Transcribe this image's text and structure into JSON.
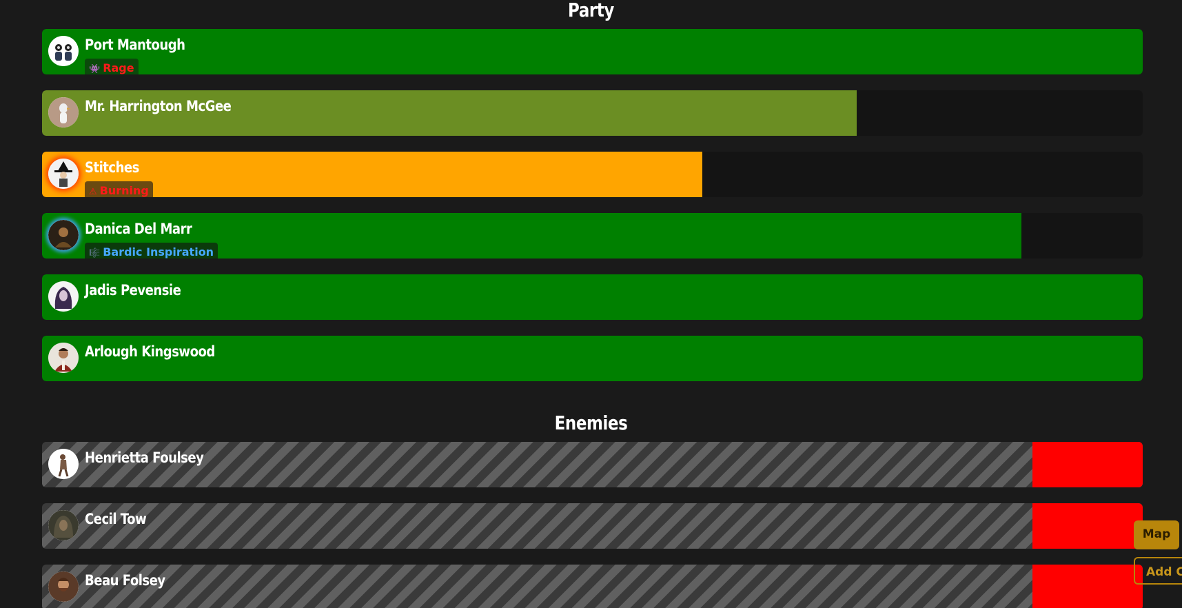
{
  "party": {
    "title": "Party",
    "members": [
      {
        "name": "Port Mantough",
        "hp_fraction": 1.0,
        "bar_color": "#008000",
        "avatar_icon": "twin-portrait-icon",
        "effect": {
          "label": "Rage",
          "glyph": "👾",
          "color": "#ff1a1a"
        }
      },
      {
        "name": "Mr. Harrington McGee",
        "hp_fraction": 0.74,
        "bar_color": "#6b8e23",
        "avatar_icon": "bird-figure-icon"
      },
      {
        "name": "Stitches",
        "hp_fraction": 0.6,
        "bar_color": "#ffa500",
        "avatar_icon": "witch-hat-icon",
        "effect": {
          "label": "Burning",
          "glyph": "⚠",
          "color": "#ff1a1a"
        }
      },
      {
        "name": "Danica Del Marr",
        "hp_fraction": 0.89,
        "bar_color": "#008000",
        "avatar_icon": "bard-portrait-icon",
        "effect": {
          "label": "Bardic Inspiration",
          "glyph": "🎼",
          "color": "#46a8ff"
        }
      },
      {
        "name": "Jadis Pevensie",
        "hp_fraction": 1.0,
        "bar_color": "#008000",
        "avatar_icon": "purple-hair-portrait-icon"
      },
      {
        "name": "Arlough Kingswood",
        "hp_fraction": 1.0,
        "bar_color": "#008000",
        "avatar_icon": "man-portrait-icon"
      }
    ]
  },
  "enemies": {
    "title": "Enemies",
    "members": [
      {
        "name": "Henrietta Foulsey",
        "hp_fraction": 0.1,
        "bar_color": "#ff0000",
        "avatar_icon": "hunched-figure-icon"
      },
      {
        "name": "Cecil Tow",
        "hp_fraction": 0.1,
        "bar_color": "#ff0000",
        "avatar_icon": "hooded-portrait-icon"
      },
      {
        "name": "Beau Folsey",
        "hp_fraction": 0.1,
        "bar_color": "#ff0000",
        "avatar_icon": "bearded-portrait-icon"
      }
    ]
  },
  "buttons": {
    "map_label": "Map",
    "add_label": "Add Co"
  }
}
